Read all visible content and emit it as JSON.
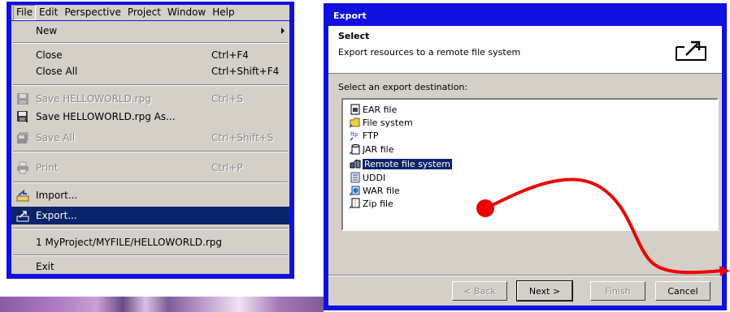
{
  "menubar": {
    "items": [
      {
        "label": "File"
      },
      {
        "label": "Edit"
      },
      {
        "label": "Perspective"
      },
      {
        "label": "Project"
      },
      {
        "label": "Window"
      },
      {
        "label": "Help"
      }
    ]
  },
  "file_menu": {
    "new": "New",
    "close": "Close",
    "close_acc": "Ctrl+F4",
    "close_all": "Close All",
    "close_all_acc": "Ctrl+Shift+F4",
    "save": "Save HELLOWORLD.rpg",
    "save_acc": "Ctrl+S",
    "save_as": "Save HELLOWORLD.rpg As...",
    "save_all": "Save All",
    "save_all_acc": "Ctrl+Shift+S",
    "print": "Print",
    "print_acc": "Ctrl+P",
    "import": "Import...",
    "export": "Export...",
    "recent": "1 MyProject/MYFILE/HELLOWORLD.rpg",
    "exit": "Exit"
  },
  "dialog": {
    "title": "Export",
    "banner_title": "Select",
    "banner_desc": "Export resources to a remote file system",
    "dest_label": "Select an export destination:",
    "destinations": [
      {
        "label": "EAR file",
        "icon": "ear-file-icon"
      },
      {
        "label": "File system",
        "icon": "folder-icon"
      },
      {
        "label": "FTP",
        "icon": "ftp-icon"
      },
      {
        "label": "JAR file",
        "icon": "jar-file-icon"
      },
      {
        "label": "Remote file system",
        "icon": "remote-system-icon",
        "selected": true
      },
      {
        "label": "UDDI",
        "icon": "uddi-icon"
      },
      {
        "label": "WAR file",
        "icon": "war-file-icon"
      },
      {
        "label": "Zip file",
        "icon": "zip-file-icon"
      }
    ],
    "buttons": {
      "back": "< Back",
      "next": "Next >",
      "finish": "Finish",
      "cancel": "Cancel"
    }
  },
  "colors": {
    "frame_blue": "#1010e0",
    "selection": "#0a246a",
    "annotation_red": "#ee0000"
  }
}
